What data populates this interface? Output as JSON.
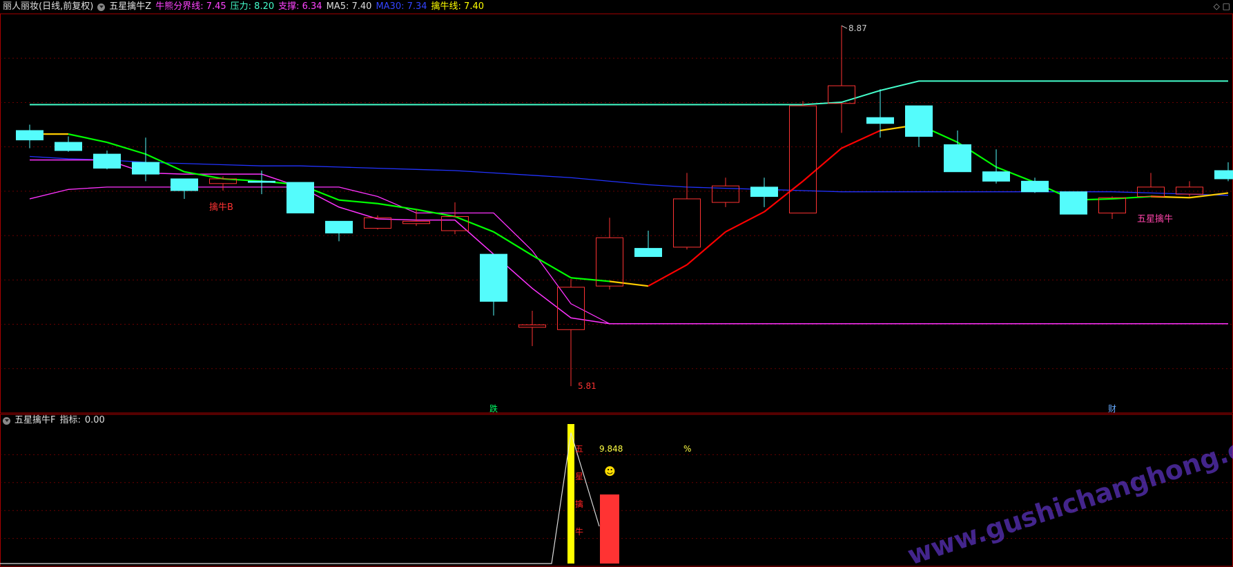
{
  "header": {
    "stock_name": "丽人丽妆(日线,前复权)",
    "indicator_name": "五星擒牛Z",
    "items": [
      {
        "label": "牛熊分界线:",
        "value": "7.45",
        "color": "#ff44ff"
      },
      {
        "label": "压力:",
        "value": "8.20",
        "color": "#44ffcc"
      },
      {
        "label": "支撑:",
        "value": "6.34",
        "color": "#ff44ff"
      },
      {
        "label": "MA5:",
        "value": "7.40",
        "color": "#dddddd"
      },
      {
        "label": "MA30:",
        "value": "7.34",
        "color": "#3344ff"
      },
      {
        "label": "擒牛线:",
        "value": "7.40",
        "color": "#ffff00"
      }
    ],
    "corner_icons": [
      "◇",
      "□"
    ]
  },
  "sub_header": {
    "indicator_name": "五星擒牛F",
    "label": "指标:",
    "value": "0.00"
  },
  "colors": {
    "up": "#ff3333",
    "down": "#54fcfc",
    "grid": "#6a0000",
    "panel_border": "#aa0000",
    "resistance": "#44ffcc",
    "ma30": "#2233ff",
    "support": "#ff33ff",
    "ma_green": "#00ff00",
    "ma_yellow": "#ffcc00",
    "ma_red": "#ff0000",
    "marker_yellow": "#ffff00"
  },
  "chart_data": {
    "type": "candlestick",
    "y_range": [
      5.6,
      9.0
    ],
    "candles": [
      {
        "o": 7.98,
        "h": 8.03,
        "l": 7.83,
        "c": 7.9
      },
      {
        "o": 7.88,
        "h": 7.93,
        "l": 7.8,
        "c": 7.81
      },
      {
        "o": 7.78,
        "h": 7.81,
        "l": 7.65,
        "c": 7.66
      },
      {
        "o": 7.71,
        "h": 7.92,
        "l": 7.55,
        "c": 7.61
      },
      {
        "o": 7.57,
        "h": 7.57,
        "l": 7.4,
        "c": 7.47
      },
      {
        "o": 7.53,
        "h": 7.59,
        "l": 7.47,
        "c": 7.57
      },
      {
        "o": 7.55,
        "h": 7.64,
        "l": 7.44,
        "c": 7.54
      },
      {
        "o": 7.54,
        "h": 7.54,
        "l": 7.28,
        "c": 7.28
      },
      {
        "o": 7.21,
        "h": 7.21,
        "l": 7.04,
        "c": 7.11
      },
      {
        "o": 7.15,
        "h": 7.26,
        "l": 7.14,
        "c": 7.24
      },
      {
        "o": 7.19,
        "h": 7.31,
        "l": 7.17,
        "c": 7.21
      },
      {
        "o": 7.13,
        "h": 7.37,
        "l": 7.1,
        "c": 7.25
      },
      {
        "o": 6.93,
        "h": 6.93,
        "l": 6.41,
        "c": 6.53
      },
      {
        "o": 6.31,
        "h": 6.45,
        "l": 6.15,
        "c": 6.33
      },
      {
        "o": 6.29,
        "h": 6.72,
        "l": 5.81,
        "c": 6.65
      },
      {
        "o": 6.66,
        "h": 7.24,
        "l": 6.63,
        "c": 7.07
      },
      {
        "o": 6.98,
        "h": 7.13,
        "l": 6.93,
        "c": 6.91
      },
      {
        "o": 6.99,
        "h": 7.62,
        "l": 6.97,
        "c": 7.4
      },
      {
        "o": 7.37,
        "h": 7.58,
        "l": 7.33,
        "c": 7.51
      },
      {
        "o": 7.5,
        "h": 7.58,
        "l": 7.33,
        "c": 7.42
      },
      {
        "o": 7.28,
        "h": 8.23,
        "l": 7.28,
        "c": 8.19
      },
      {
        "o": 8.21,
        "h": 8.87,
        "l": 7.96,
        "c": 8.36
      },
      {
        "o": 8.09,
        "h": 8.33,
        "l": 7.92,
        "c": 8.04
      },
      {
        "o": 8.19,
        "h": 8.19,
        "l": 7.84,
        "c": 7.93
      },
      {
        "o": 7.86,
        "h": 7.98,
        "l": 7.63,
        "c": 7.63
      },
      {
        "o": 7.63,
        "h": 7.82,
        "l": 7.53,
        "c": 7.55
      },
      {
        "o": 7.55,
        "h": 7.58,
        "l": 7.45,
        "c": 7.46
      },
      {
        "o": 7.46,
        "h": 7.46,
        "l": 7.3,
        "c": 7.27
      },
      {
        "o": 7.28,
        "h": 7.42,
        "l": 7.23,
        "c": 7.41
      },
      {
        "o": 7.42,
        "h": 7.62,
        "l": 7.42,
        "c": 7.5
      },
      {
        "o": 7.44,
        "h": 7.55,
        "l": 7.42,
        "c": 7.5
      },
      {
        "o": 7.64,
        "h": 7.71,
        "l": 7.55,
        "c": 7.57
      }
    ],
    "resistance_line": [
      8.2,
      8.2,
      8.2,
      8.2,
      8.2,
      8.2,
      8.2,
      8.2,
      8.2,
      8.2,
      8.2,
      8.2,
      8.2,
      8.2,
      8.2,
      8.2,
      8.2,
      8.2,
      8.2,
      8.2,
      8.2,
      8.22,
      8.32,
      8.4,
      8.4,
      8.4,
      8.4,
      8.4,
      8.4,
      8.4,
      8.4,
      8.4
    ],
    "ma30_line": [
      7.76,
      7.74,
      7.73,
      7.71,
      7.7,
      7.69,
      7.68,
      7.68,
      7.67,
      7.66,
      7.65,
      7.64,
      7.62,
      7.6,
      7.58,
      7.55,
      7.52,
      7.5,
      7.49,
      7.48,
      7.47,
      7.46,
      7.46,
      7.46,
      7.46,
      7.46,
      7.46,
      7.46,
      7.46,
      7.45,
      7.44,
      7.43
    ],
    "support_line": [
      7.4,
      7.48,
      7.5,
      7.5,
      7.5,
      7.5,
      7.5,
      7.5,
      7.5,
      7.42,
      7.28,
      7.28,
      7.28,
      6.96,
      6.51,
      6.34,
      6.34,
      6.34,
      6.34,
      6.34,
      6.34,
      6.34,
      6.34,
      6.34,
      6.34,
      6.34,
      6.34,
      6.34,
      6.34,
      6.34,
      6.34,
      6.34
    ],
    "pink_line": [
      7.73,
      7.73,
      7.73,
      7.62,
      7.61,
      7.61,
      7.61,
      7.5,
      7.33,
      7.23,
      7.22,
      7.22,
      6.93,
      6.64,
      6.39,
      6.34,
      6.34,
      6.34,
      6.34,
      6.34,
      6.34,
      6.34,
      6.34,
      6.34,
      6.34,
      6.34,
      6.34,
      6.34,
      6.34,
      6.34,
      6.34,
      6.34
    ],
    "qiniu_line": [
      7.95,
      7.95,
      7.88,
      7.78,
      7.63,
      7.57,
      7.55,
      7.52,
      7.39,
      7.36,
      7.31,
      7.25,
      7.12,
      6.92,
      6.73,
      6.7,
      6.66,
      6.84,
      7.12,
      7.29,
      7.55,
      7.83,
      7.98,
      8.03,
      7.88,
      7.67,
      7.54,
      7.39,
      7.4,
      7.42,
      7.41,
      7.45
    ],
    "qiniu_color": [
      "#ffcc00",
      "#ffcc00",
      "#00ff00",
      "#00ff00",
      "#00ff00",
      "#00ff00",
      "#00ff00",
      "#00ff00",
      "#00ff00",
      "#00ff00",
      "#00ff00",
      "#00ff00",
      "#00ff00",
      "#00ff00",
      "#00ff00",
      "#00ff00",
      "#ffcc00",
      "#ff0000",
      "#ff0000",
      "#ff0000",
      "#ff0000",
      "#ff0000",
      "#ff0000",
      "#ffcc00",
      "#00ff00",
      "#00ff00",
      "#00ff00",
      "#00ff00",
      "#00ff00",
      "#00ff00",
      "#ffcc00",
      "#ffcc00"
    ],
    "labels": [
      {
        "i": 5,
        "price": 7.47,
        "text": "擒牛B",
        "color": "#ff3333"
      },
      {
        "i": 14,
        "price": 5.81,
        "text": "5.81",
        "color": "#ff3333"
      },
      {
        "i": 21,
        "price": 8.87,
        "text": "8.87",
        "color": "#cccccc"
      },
      {
        "i": 29,
        "price": 7.37,
        "text": "五星擒牛",
        "color": "#ff44aa"
      }
    ],
    "bottom_marks": [
      {
        "i": 12,
        "text": "跌",
        "color": "#00ff66"
      },
      {
        "i": 28,
        "text": "财",
        "color": "#66aaff"
      }
    ],
    "sub": {
      "y_range": [
        0,
        10.5
      ],
      "line": [
        [
          0,
          0
        ],
        [
          13,
          0
        ],
        [
          14,
          9.848
        ],
        [
          15,
          2.8
        ]
      ],
      "yellow_bar": {
        "i": 14,
        "value": 10.5
      },
      "red_bar": {
        "i": 15,
        "value": 5.2
      },
      "vertical_text": [
        "五",
        "星",
        "擒",
        "牛"
      ],
      "value_text": "9.848",
      "percent_text": "%",
      "smiley": "☻"
    }
  },
  "watermark": "www.gushichanghong.com"
}
